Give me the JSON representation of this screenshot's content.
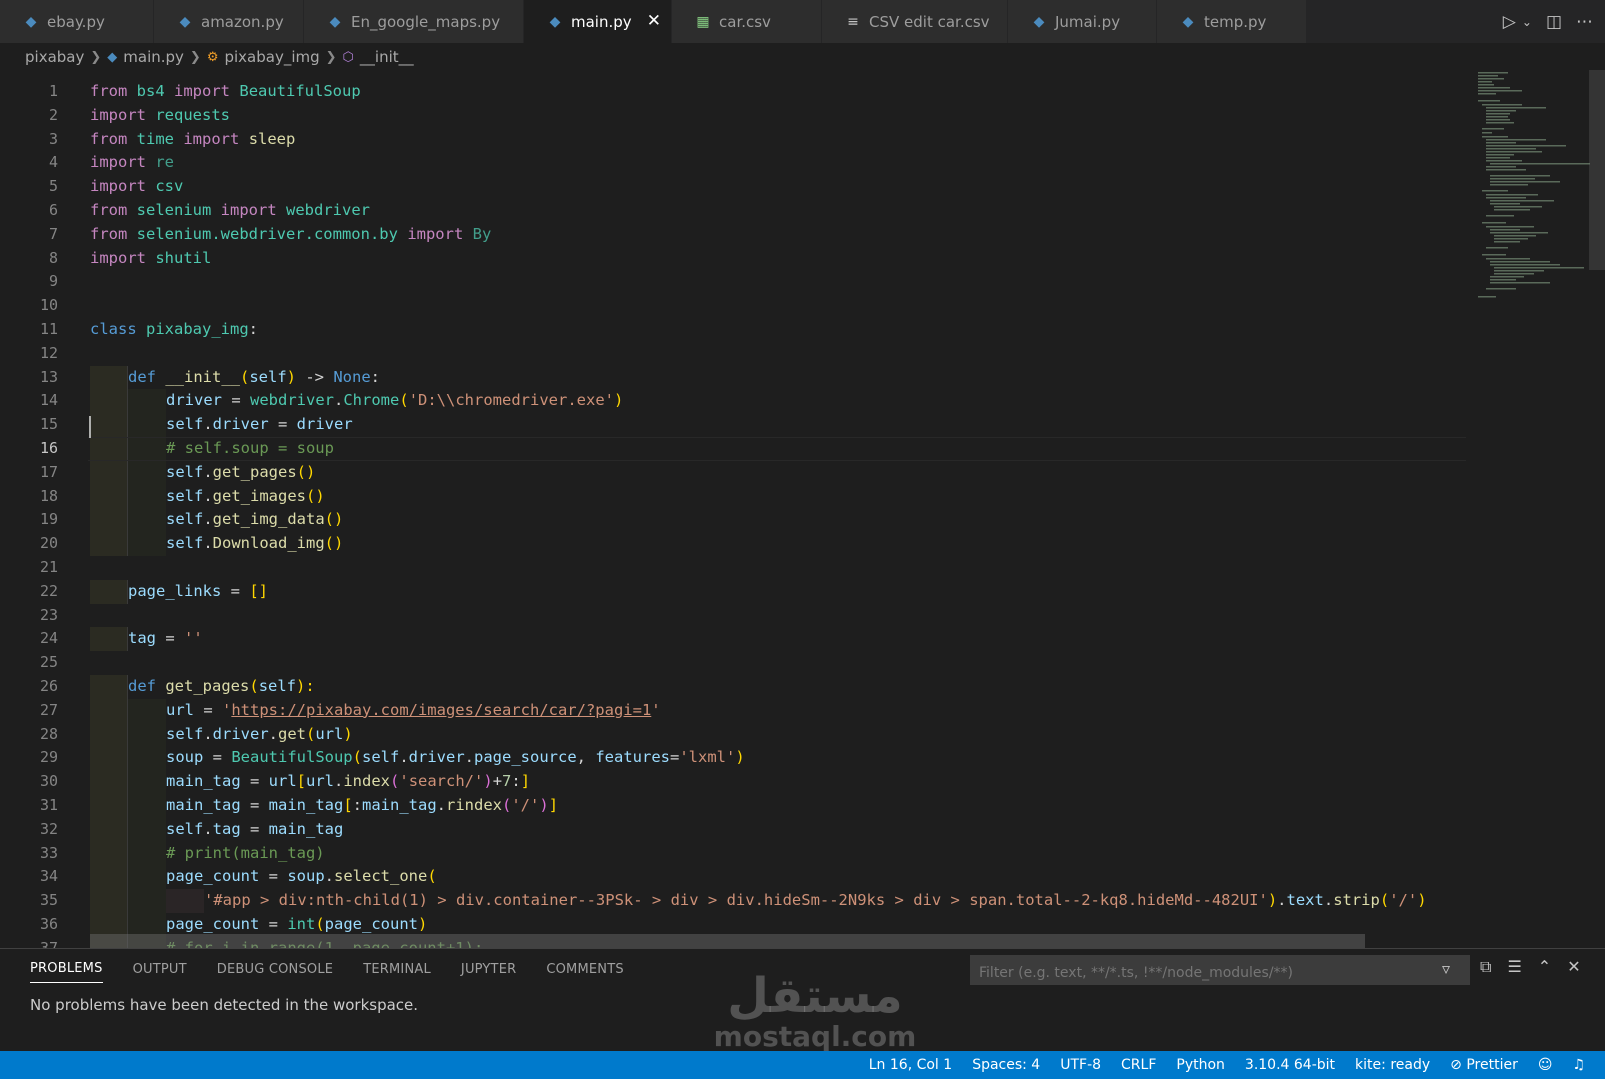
{
  "tabs": [
    {
      "label": "ebay.py",
      "icon": "python-icon",
      "active": false
    },
    {
      "label": "amazon.py",
      "icon": "python-icon",
      "active": false
    },
    {
      "label": "En_google_maps.py",
      "icon": "python-icon",
      "active": false
    },
    {
      "label": "main.py",
      "icon": "python-icon",
      "active": true
    },
    {
      "label": "car.csv",
      "icon": "table-icon",
      "active": false
    },
    {
      "label": "CSV edit car.csv",
      "icon": "list-icon",
      "active": false
    },
    {
      "label": "Jumai.py",
      "icon": "python-icon",
      "active": false
    },
    {
      "label": "temp.py",
      "icon": "python-icon",
      "active": false
    }
  ],
  "breadcrumb": [
    "pixabay",
    "main.py",
    "pixabay_img",
    "__init__"
  ],
  "editor": {
    "active_line": 16,
    "line_numbers": [
      "1",
      "2",
      "3",
      "4",
      "5",
      "6",
      "7",
      "8",
      "9",
      "10",
      "11",
      "12",
      "13",
      "14",
      "15",
      "16",
      "17",
      "18",
      "19",
      "20",
      "21",
      "22",
      "23",
      "24",
      "25",
      "26",
      "27",
      "28",
      "29",
      "30",
      "31",
      "32",
      "33",
      "34",
      "35",
      "36",
      "37"
    ],
    "code": {
      "l1": [
        "from",
        "bs4",
        "import",
        "BeautifulSoup"
      ],
      "l2": [
        "import",
        "requests"
      ],
      "l3": [
        "from",
        "time",
        "import",
        "sleep"
      ],
      "l4": [
        "import",
        "re"
      ],
      "l5": [
        "import",
        "csv"
      ],
      "l6": [
        "from",
        "selenium",
        "import",
        "webdriver"
      ],
      "l7": [
        "from",
        "selenium.webdriver.common.by",
        "import",
        "By"
      ],
      "l8": [
        "import",
        "shutil"
      ],
      "l11": [
        "class",
        "pixabay_img",
        ":"
      ],
      "l13": [
        "def",
        "__init__",
        "(",
        "self",
        ")",
        " -> ",
        "None",
        ":"
      ],
      "l14": [
        "driver",
        " = ",
        "webdriver",
        ".",
        "Chrome",
        "(",
        "'D:\\\\chromedriver.exe'",
        ")"
      ],
      "l15": [
        "self",
        ".",
        "driver",
        " = ",
        "driver"
      ],
      "l16": "# self.soup = soup",
      "l17": [
        "self",
        ".",
        "get_pages",
        "()"
      ],
      "l18": [
        "self",
        ".",
        "get_images",
        "()"
      ],
      "l19": [
        "self",
        ".",
        "get_img_data",
        "()"
      ],
      "l20": [
        "self",
        ".",
        "Download_img",
        "()"
      ],
      "l22": [
        "page_links",
        " = ",
        "[]"
      ],
      "l24": [
        "tag",
        " = ",
        "''"
      ],
      "l26": [
        "def",
        "get_pages",
        "(",
        "self",
        "):"
      ],
      "l27": [
        "url",
        " = ",
        "'",
        "https://pixabay.com/images/search/car/?pagi=1",
        "'"
      ],
      "l28": [
        "self",
        ".",
        "driver",
        ".",
        "get",
        "(",
        "url",
        ")"
      ],
      "l29": [
        "soup",
        " = ",
        "BeautifulSoup",
        "(",
        "self",
        ".",
        "driver",
        ".",
        "page_source",
        ", ",
        "features",
        "=",
        "'lxml'",
        ")"
      ],
      "l30": [
        "main_tag",
        " = ",
        "url",
        "[",
        "url",
        ".",
        "index",
        "(",
        "'search/'",
        ")",
        "+",
        "7",
        ":",
        "]"
      ],
      "l31": [
        "main_tag",
        " = ",
        "main_tag",
        "[",
        ":",
        "main_tag",
        ".",
        "rindex",
        "(",
        "'/'",
        ")",
        "]"
      ],
      "l32": [
        "self",
        ".",
        "tag",
        " = ",
        "main_tag"
      ],
      "l33": "# print(main_tag)",
      "l34": [
        "page_count",
        " = ",
        "soup",
        ".",
        "select_one",
        "("
      ],
      "l35": [
        "'#app > div:nth-child(1) > div.container--3PSk- > div > div.hideSm--2N9ks > div > span.total--2-kq8.hideMd--482UI'",
        ")",
        ".",
        "text",
        ".",
        "strip",
        "(",
        "'/'",
        ")"
      ],
      "l36": [
        "page_count",
        " = ",
        "int",
        "(",
        "page_count",
        ")"
      ],
      "l37": "# for i in range(1, page_count+1):"
    }
  },
  "panel": {
    "tabs": [
      "PROBLEMS",
      "OUTPUT",
      "DEBUG CONSOLE",
      "TERMINAL",
      "JUPYTER",
      "COMMENTS"
    ],
    "filter_placeholder": "Filter (e.g. text, **/*.ts, !**/node_modules/**)",
    "message": "No problems have been detected in the workspace."
  },
  "watermark": {
    "arabic": "مستقل",
    "latin": "mostaql.com"
  },
  "status_bar": {
    "position": "Ln 16, Col 1",
    "spaces": "Spaces: 4",
    "encoding": "UTF-8",
    "eol": "CRLF",
    "language": "Python",
    "interpreter": "3.10.4 64-bit",
    "kite": "kite: ready",
    "prettier": "Prettier"
  },
  "colors": {
    "status_bar": "#007acc",
    "editor_bg": "#1e1e1e",
    "tab_bar": "#252526"
  }
}
